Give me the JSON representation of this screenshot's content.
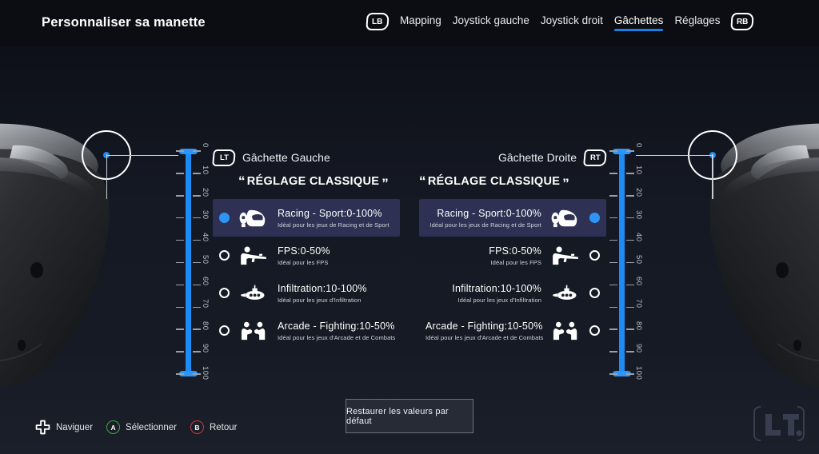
{
  "header": {
    "title": "Personnaliser sa manette",
    "left_bumper": "LB",
    "right_bumper": "RB",
    "nav": [
      {
        "label": "Mapping",
        "active": false
      },
      {
        "label": "Joystick gauche",
        "active": false
      },
      {
        "label": "Joystick droit",
        "active": false
      },
      {
        "label": "Gâchettes",
        "active": true
      },
      {
        "label": "Réglages",
        "active": false
      }
    ],
    "accent_color": "#1e7fe0"
  },
  "rulers": {
    "ticks": [
      "0",
      "10",
      "20",
      "30",
      "40",
      "50",
      "60",
      "70",
      "80",
      "90",
      "100"
    ],
    "bar_color": "#1e8bf5",
    "min": 0,
    "max": 100
  },
  "triggers": {
    "left": {
      "badge": "LT",
      "title": "Gâchette Gauche",
      "preset_label": "RÉGLAGE CLASSIQUE",
      "quote_open": "“",
      "quote_close": "”",
      "options": [
        {
          "title": "Racing - Sport:0-100%",
          "subtitle": "Idéal pour les jeux de Racing et de Sport",
          "icon": "helmet-icon",
          "selected": true
        },
        {
          "title": "FPS:0-50%",
          "subtitle": "Idéal pour les FPS",
          "icon": "shooter-icon",
          "selected": false
        },
        {
          "title": "Infiltration:10-100%",
          "subtitle": "Idéal pour les jeux d'Infiltration",
          "icon": "submarine-icon",
          "selected": false
        },
        {
          "title": "Arcade - Fighting:10-50%",
          "subtitle": "Idéal pour les jeux d'Arcade et de Combats",
          "icon": "fighting-icon",
          "selected": false
        }
      ]
    },
    "right": {
      "badge": "RT",
      "title": "Gâchette Droite",
      "preset_label": "RÉGLAGE CLASSIQUE",
      "quote_open": "“",
      "quote_close": "”",
      "options": [
        {
          "title": "Racing - Sport:0-100%",
          "subtitle": "Idéal pour les jeux de Racing et de Sport",
          "icon": "helmet-icon",
          "selected": true
        },
        {
          "title": "FPS:0-50%",
          "subtitle": "Idéal pour les FPS",
          "icon": "shooter-icon",
          "selected": false
        },
        {
          "title": "Infiltration:10-100%",
          "subtitle": "Idéal pour les jeux d'Infiltration",
          "icon": "submarine-icon",
          "selected": false
        },
        {
          "title": "Arcade - Fighting:10-50%",
          "subtitle": "Idéal pour les jeux d'Arcade et de Combats",
          "icon": "fighting-icon",
          "selected": false
        }
      ]
    }
  },
  "footer": {
    "hints": [
      {
        "glyph": "dpad-icon",
        "label": "Naviguer",
        "color": "#ffffff"
      },
      {
        "glyph": "A",
        "label": "Sélectionner",
        "color": "#3faa3f"
      },
      {
        "glyph": "B",
        "label": "Retour",
        "color": "#d7343c"
      }
    ],
    "restore_button": "Restaurer les valeurs par défaut",
    "watermark": "LT."
  }
}
